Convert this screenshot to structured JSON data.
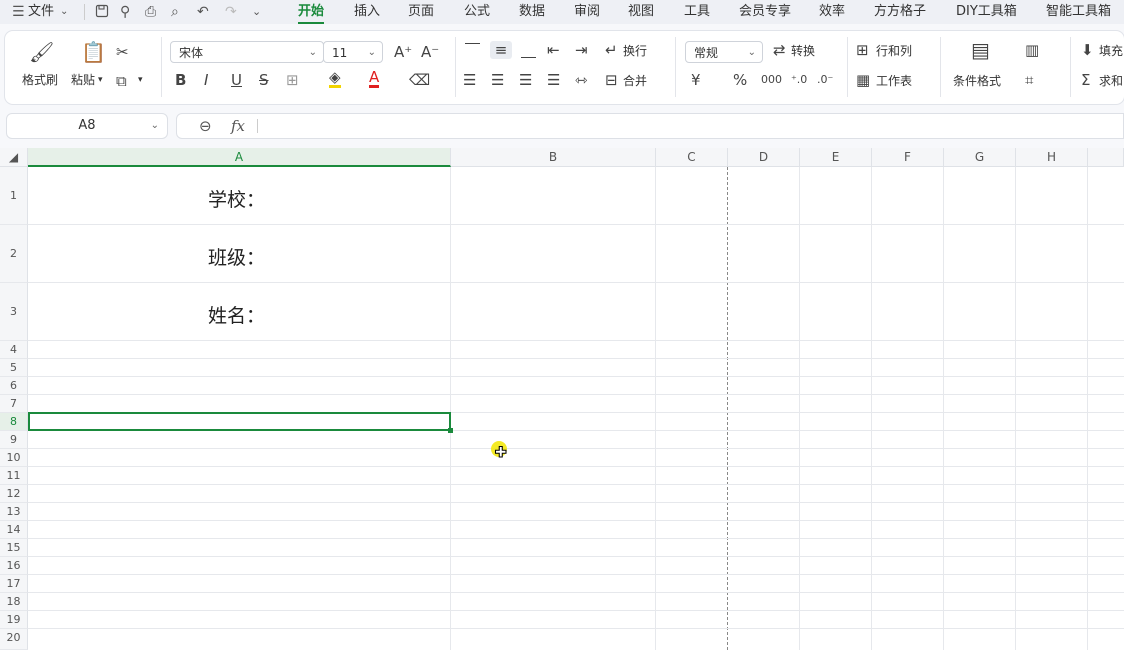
{
  "menubar": {
    "file_menu": "文件",
    "tabs": [
      "开始",
      "插入",
      "页面",
      "公式",
      "数据",
      "审阅",
      "视图",
      "工具",
      "会员专享",
      "效率",
      "方方格子",
      "DIY工具箱",
      "智能工具箱"
    ],
    "active_tab": "开始"
  },
  "ribbon": {
    "format_painter": "格式刷",
    "paste": "粘贴",
    "font_name": "宋体",
    "font_size": "11",
    "wrap_text": "换行",
    "merge": "合并",
    "number_format": "常规",
    "convert": "转换",
    "rows_cols": "行和列",
    "worksheet": "工作表",
    "conditional_format": "条件格式",
    "fill": "填充",
    "sum": "求和",
    "accent_color": "#1a8a3c",
    "font_color": "#e02020",
    "highlight_color": "#f2d400"
  },
  "formula_bar": {
    "name_box": "A8",
    "fx_label": "fx",
    "content": ""
  },
  "sheet": {
    "columns": [
      "A",
      "B",
      "C",
      "D",
      "E",
      "F",
      "G",
      "H"
    ],
    "rows": [
      "1",
      "2",
      "3",
      "4",
      "5",
      "6",
      "7",
      "8",
      "9",
      "10",
      "11",
      "12",
      "13",
      "14",
      "15",
      "16",
      "17",
      "18",
      "19",
      "20"
    ],
    "selected_cell": "A8",
    "cells": {
      "A1": "学校：",
      "A2": "班级：",
      "A3": "姓名："
    }
  }
}
